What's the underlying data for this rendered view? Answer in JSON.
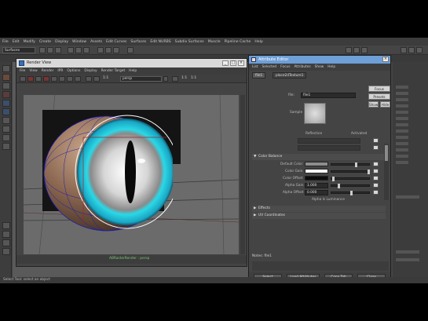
{
  "app": {
    "main_menu": [
      "File",
      "Edit",
      "Modify",
      "Create",
      "Display",
      "Window",
      "Assets",
      "Edit Curves",
      "Surfaces",
      "Edit NURBS",
      "Subdiv Surfaces",
      "Muscle",
      "Pipeline Cache",
      "Help"
    ],
    "mode_selector": "Surfaces",
    "help_line": "Select Tool: select an object"
  },
  "render_view": {
    "title": "Render View",
    "menu": [
      "File",
      "View",
      "Render",
      "IPR",
      "Options",
      "Display",
      "Render Target",
      "Help"
    ],
    "camera_dropdown": "persp",
    "ratio_labels": [
      "1:1",
      "1:1",
      "1:1"
    ],
    "footer_caption": "ABRasterRender : persp"
  },
  "attribute_editor": {
    "title": "Attribute Editor",
    "menu": [
      "List",
      "Selected",
      "Focus",
      "Attributes",
      "Show",
      "Help"
    ],
    "tabs": [
      "file1",
      "place2dTexture1"
    ],
    "file_label": "file:",
    "file_value": "file1",
    "side_buttons": [
      "Focus",
      "Presets",
      "Show",
      "Hide"
    ],
    "sample_label": "Sample",
    "checkbox_labels": [
      "Reflection",
      "Activated"
    ],
    "section_color_balance": "Color Balance",
    "color_rows": [
      {
        "label": "Default Color",
        "value": ""
      },
      {
        "label": "Color Gain",
        "value": ""
      },
      {
        "label": "Color Offset",
        "value": ""
      },
      {
        "label": "Alpha Gain",
        "value": "1.000"
      },
      {
        "label": "Alpha Offset",
        "value": "0.000"
      }
    ],
    "alpha_luminance_label": "Alpha Is Luminance",
    "sections_collapsed": [
      "Effects",
      "UV Coordinates"
    ],
    "notes_label": "Notes: file1",
    "bottom_buttons": [
      "Select",
      "Load Attributes",
      "Copy Tab",
      "Close"
    ]
  },
  "colors": {
    "accent_title": "#6e9fd6",
    "iris": "#2bd8e6",
    "wireframe": "#1b1bb0"
  }
}
